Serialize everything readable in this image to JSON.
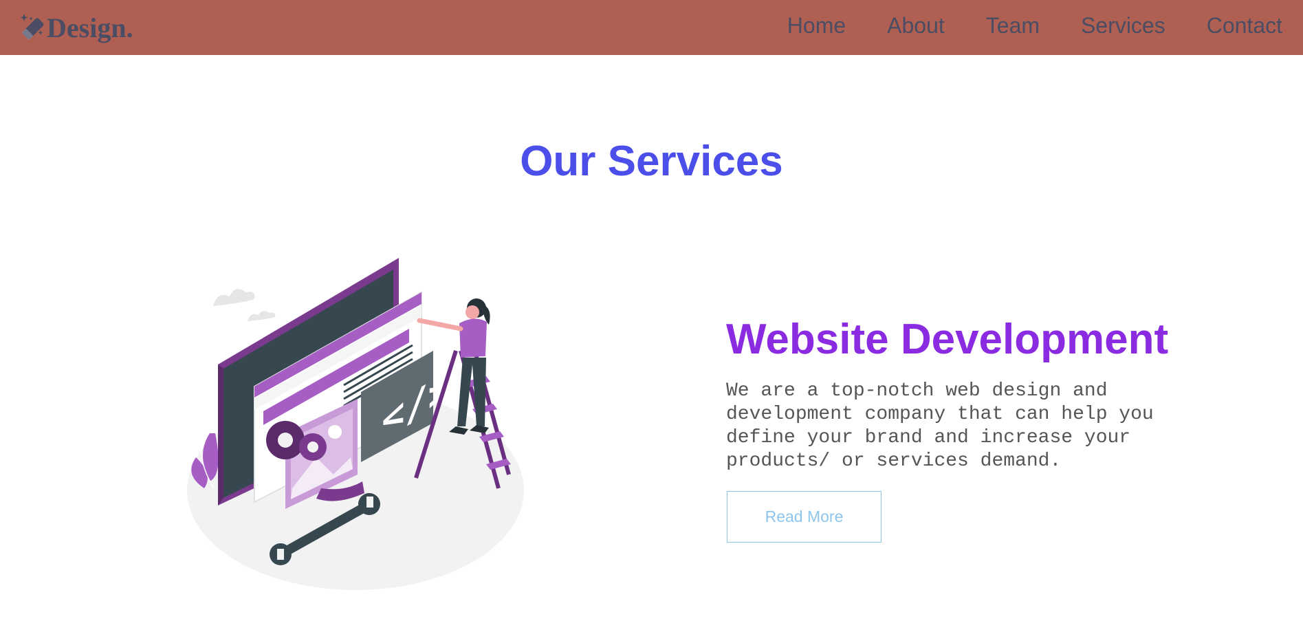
{
  "brand": {
    "name": "Design.",
    "icon": "magic-wand-icon"
  },
  "nav": {
    "items": [
      {
        "label": "Home"
      },
      {
        "label": "About"
      },
      {
        "label": "Team"
      },
      {
        "label": "Services"
      },
      {
        "label": "Contact"
      }
    ]
  },
  "services": {
    "title": "Our Services",
    "item": {
      "heading": "Website Development",
      "description": "We are a top-notch web design and development company that can help you define your brand and increase your products/ or services demand.",
      "button_label": "Read More",
      "illustration": "web-development-illustration-icon"
    }
  },
  "colors": {
    "navbar_bg": "#b06052",
    "nav_text": "#4a4d63",
    "title": "#4b4ee8",
    "heading": "#8a2be2",
    "button": "#8ec5ec",
    "illustration_purple": "#a65ec4"
  }
}
